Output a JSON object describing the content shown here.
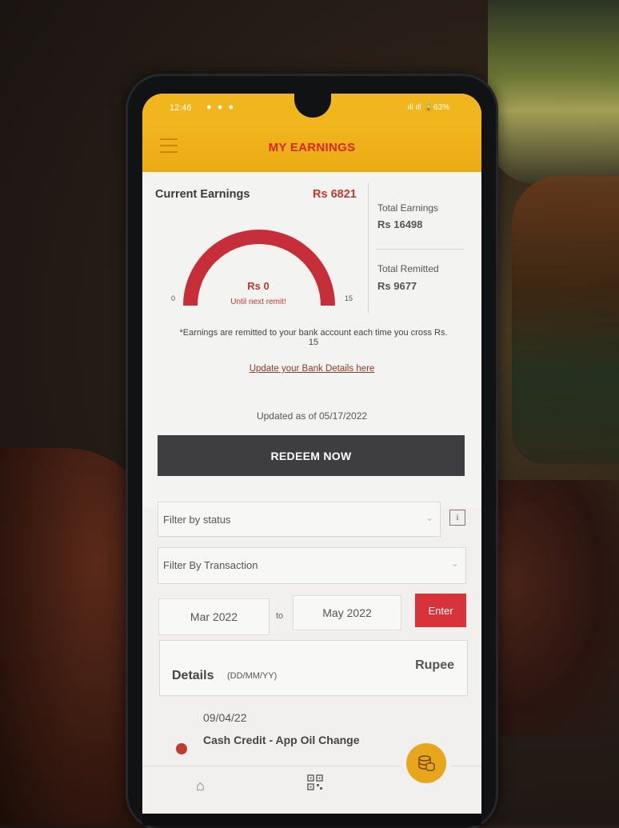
{
  "status_bar": {
    "time": "12:46",
    "indicators": "● ● ●",
    "signal_battery": "ıll ıll 🔒63%"
  },
  "app_bar": {
    "title": "MY EARNINGS",
    "menu_icon": "hamburger-icon"
  },
  "earnings": {
    "current_label": "Current Earnings",
    "current_value": "Rs 6821",
    "gauge": {
      "min": "0",
      "max": "15",
      "value": "Rs 0",
      "progress": 1.0,
      "subtitle": "Until next remit!",
      "color": "#c62f3a"
    },
    "total_label": "Total Earnings",
    "total_value": "Rs 16498",
    "remitted_label": "Total Remitted",
    "remitted_value": "Rs 9677",
    "note": "*Earnings are remitted to your bank account each time you cross Rs. 15",
    "update_link": "Update your Bank Details here",
    "updated_as_of": "Updated as of 05/17/2022"
  },
  "redeem_button": "REDEEM NOW",
  "filters": {
    "status_placeholder": "Filter by status",
    "transaction_placeholder": "Filter By Transaction",
    "info_icon": "i",
    "from_date": "Mar 2022",
    "to_label": "to",
    "to_date": "May 2022",
    "enter_button": "Enter"
  },
  "details": {
    "title": "Details",
    "format": "(DD/MM/YY)",
    "currency": "Rupee"
  },
  "transactions": [
    {
      "date": "09/04/22",
      "description": "Cash Credit - App Oil Change"
    }
  ],
  "nav": {
    "home_icon": "home-icon",
    "qr_icon": "qr-code-icon",
    "coins_icon": "coins-icon"
  },
  "colors": {
    "accent": "#f1b51e",
    "title_red": "#d92820",
    "button_dark": "#3e3d3f",
    "enter_red": "#d8333b"
  }
}
